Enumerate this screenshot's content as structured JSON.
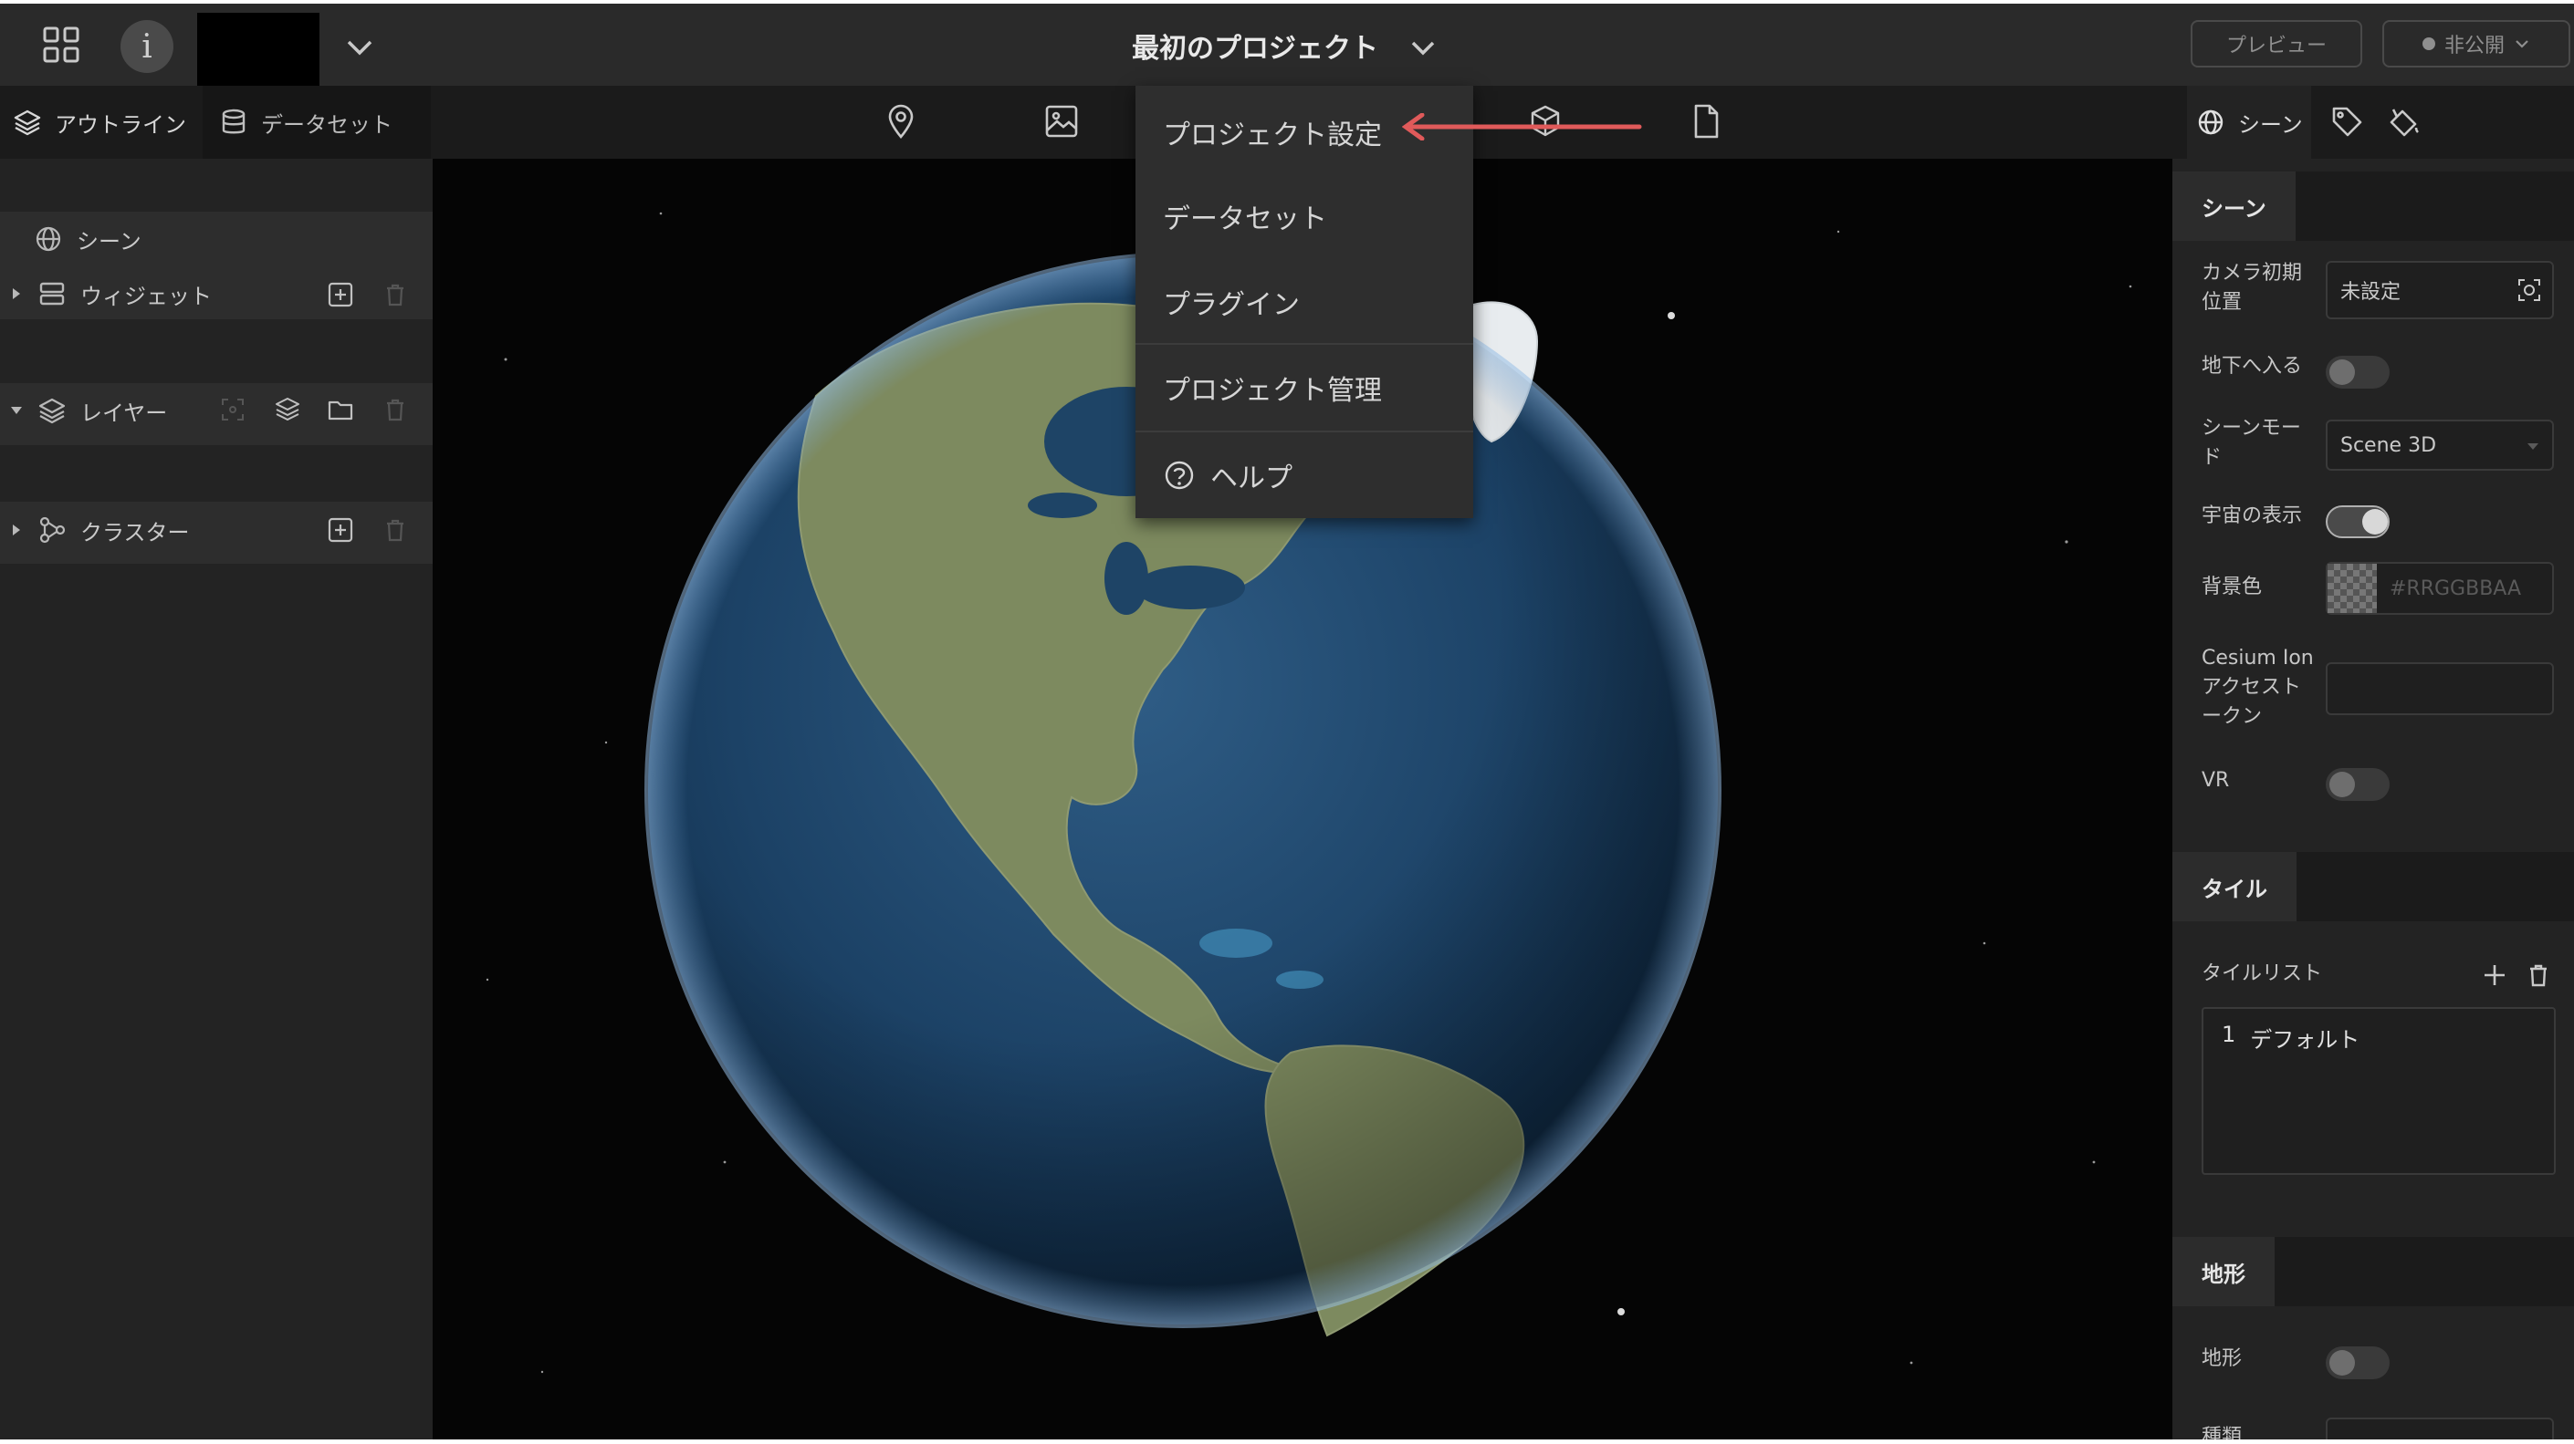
{
  "header": {
    "title": "最初のプロジェクト",
    "info_label": "i",
    "preview_label": "プレビュー",
    "publish_label": "非公開"
  },
  "toolbar": {
    "tabs": [
      {
        "label": "アウトライン",
        "icon": "layers-icon"
      },
      {
        "label": "データセット",
        "icon": "database-icon"
      }
    ],
    "tools": [
      "map-pin-icon",
      "image-icon",
      "cube-icon",
      "file-icon"
    ],
    "right_tabs": [
      {
        "label": "シーン",
        "icon": "globe-icon"
      },
      {
        "label": "",
        "icon": "tag-icon"
      },
      {
        "label": "",
        "icon": "bucket-icon"
      }
    ]
  },
  "outline": {
    "scene_label": "シーン",
    "widget_label": "ウィジェット",
    "layer_label": "レイヤー",
    "cluster_label": "クラスター"
  },
  "menu": {
    "items": [
      "プロジェクト設定",
      "データセット",
      "プラグイン",
      "プロジェクト管理",
      "ヘルプ"
    ],
    "highlight_color": "#e05a5a"
  },
  "scene_panel": {
    "section_title": "シーン",
    "camera_label": "カメラ初期位置",
    "camera_value": "未設定",
    "underground_label": "地下へ入る",
    "underground_on": false,
    "scene_mode_label": "シーンモード",
    "scene_mode_value": "Scene 3D",
    "space_label": "宇宙の表示",
    "space_on": true,
    "bg_color_label": "背景色",
    "bg_color_placeholder": "#RRGGBBAA",
    "ion_label": "Cesium Ion アクセストークン",
    "ion_value": "",
    "vr_label": "VR",
    "vr_on": false
  },
  "tile_panel": {
    "section_title": "タイル",
    "list_label": "タイルリスト",
    "items": [
      {
        "index": "1",
        "name": "デフォルト"
      }
    ]
  },
  "terrain_panel": {
    "section_title": "地形",
    "terrain_label": "地形",
    "terrain_on": false,
    "type_label": "種類"
  }
}
